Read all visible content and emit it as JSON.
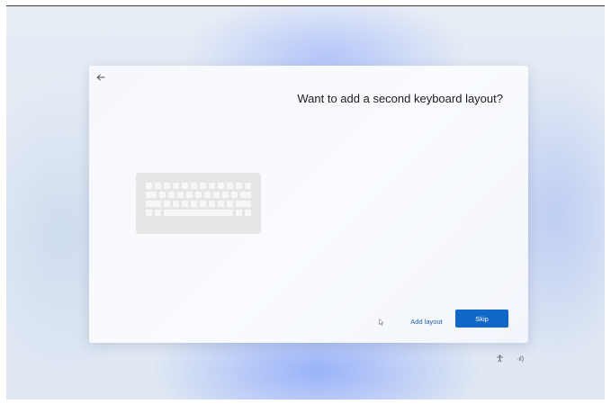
{
  "dialog": {
    "title": "Want to add a second keyboard layout?",
    "back_icon": "arrow-left-icon",
    "illustration_icon": "keyboard-icon"
  },
  "actions": {
    "add_layout_label": "Add layout",
    "skip_label": "Skip"
  },
  "status_bar": {
    "accessibility_icon": "accessibility-icon",
    "volume_label": "·ıl)"
  },
  "colors": {
    "accent": "#1167c8",
    "link": "#1f5fae",
    "window_bg": "#f6f8fd",
    "keyboard_bg": "#e6e6e6"
  }
}
